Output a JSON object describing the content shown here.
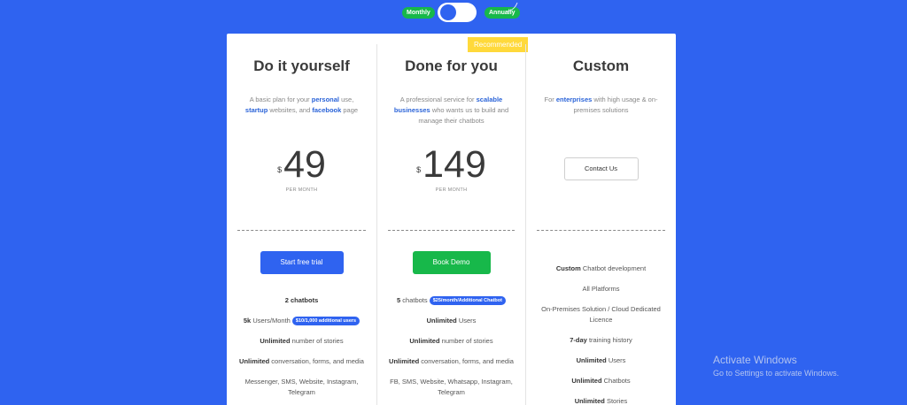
{
  "toggle": {
    "monthly_label": "Monthly",
    "annually_label": "Annually"
  },
  "badge": "Recommended",
  "plans": [
    {
      "title": "Do it yourself",
      "desc": {
        "t1": "A basic plan for your ",
        "h1": "personal",
        "t2": " use, ",
        "h2": "startup",
        "t3": " websites, and ",
        "h3": "facebook",
        "t4": " page"
      },
      "currency": "$",
      "price": "49",
      "per": "PER MONTH",
      "cta": "Start free trial",
      "features": {
        "f1_bold": "2 chatbots",
        "f2_bold": "5k",
        "f2_text": " Users/Month ",
        "f2_chip": "$10/1,000 additional users",
        "f3_bold": "Unlimited",
        "f3_text": " number of stories",
        "f4_bold": "Unlimited",
        "f4_text": " conversation, forms, and media",
        "f5_text": "Messenger, SMS, Website, Instagram, Telegram"
      }
    },
    {
      "title": "Done for you",
      "desc": {
        "t1": "A professional service for ",
        "h1": "scalable businesses",
        "t2": " who wants us to build and manage their chatbots"
      },
      "currency": "$",
      "price": "149",
      "per": "PER MONTH",
      "cta": "Book Demo",
      "features": {
        "f1_bold": "5",
        "f1_text": " chatbots ",
        "f1_chip": "$25/month/Additional Chatbot",
        "f2_bold": "Unlimited",
        "f2_text": " Users",
        "f3_bold": "Unlimited",
        "f3_text": " number of stories",
        "f4_bold": "Unlimited",
        "f4_text": " conversation, forms, and media",
        "f5_text": "FB, SMS, Website, Whatsapp, Instagram, Telegram"
      }
    },
    {
      "title": "Custom",
      "desc": {
        "t1": "For ",
        "h1": "enterprises",
        "t2": " with high usage & on-premises solutions"
      },
      "cta": "Contact Us",
      "features": {
        "f1_bold": "Custom",
        "f1_text": " Chatbot development",
        "f2_text": "All Platforms",
        "f3_text": "On-Premises Solution / Cloud Dedicated Licence",
        "f4_bold": "7-day",
        "f4_text": " training history",
        "f5_bold": "Unlimited",
        "f5_text": " Users",
        "f6_bold": "Unlimited",
        "f6_text": " Chatbots",
        "f7_bold": "Unlimited",
        "f7_text": " Stories"
      }
    }
  ],
  "watermark": {
    "line1": "Activate Windows",
    "line2": "Go to Settings to activate Windows."
  },
  "colors": {
    "background": "#2f63f0",
    "primary": "#2f63f0",
    "success": "#17b84a",
    "badge": "#ffd93b"
  }
}
